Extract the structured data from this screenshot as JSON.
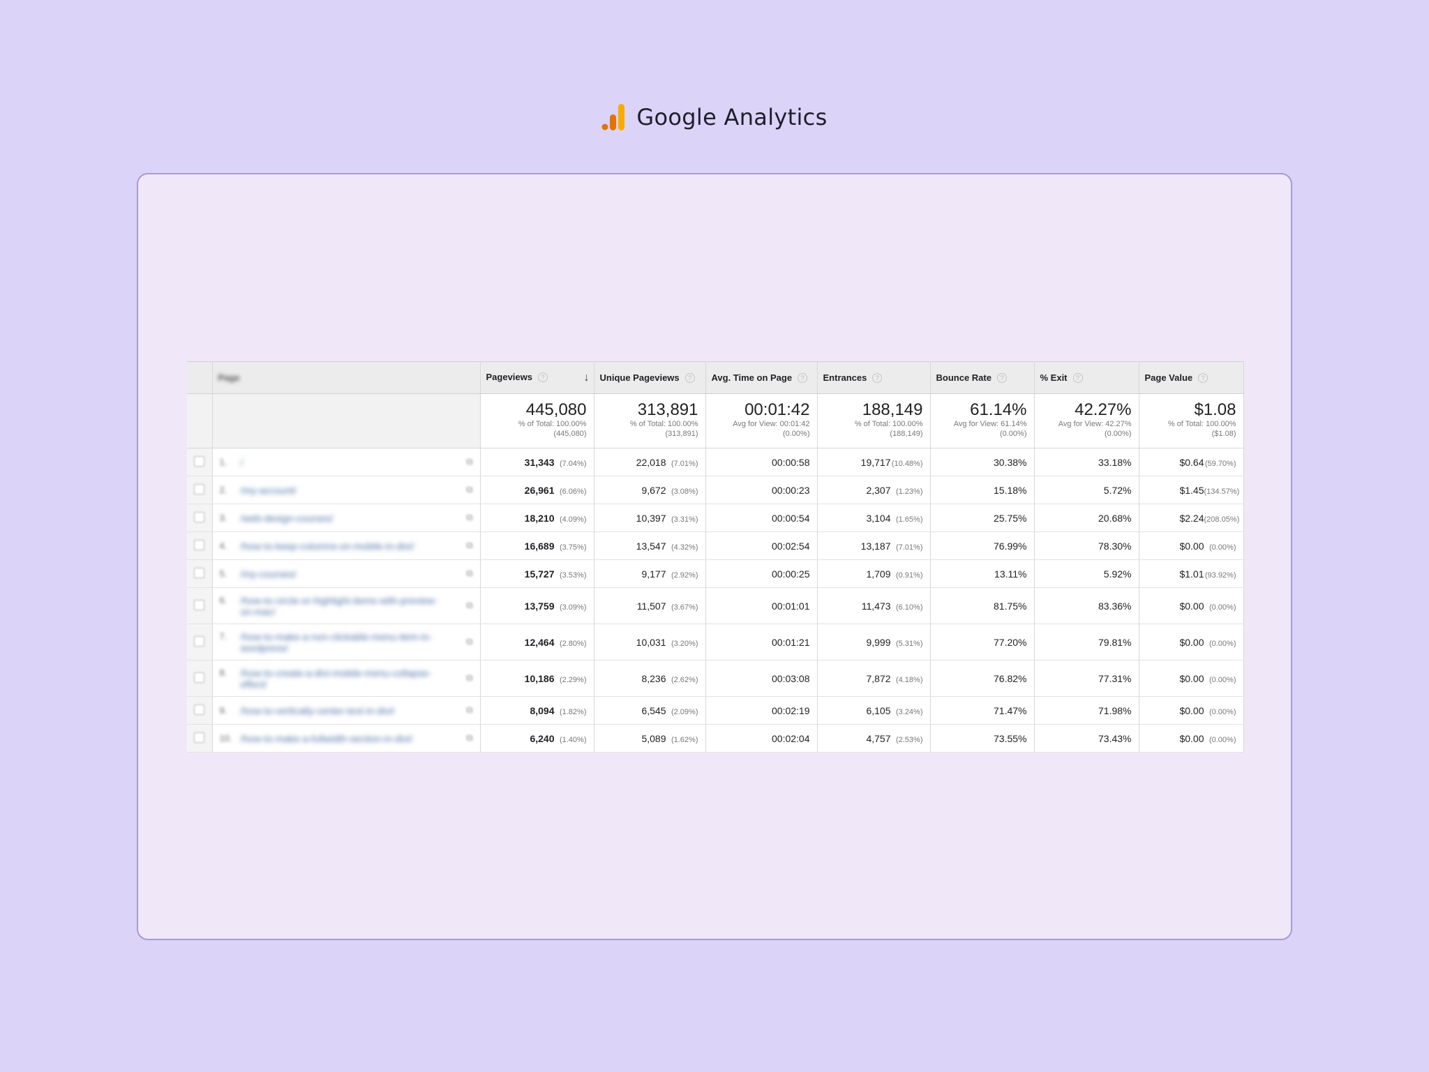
{
  "brand": {
    "title": "Google Analytics",
    "icon": "analytics-bars-icon",
    "colors": [
      "#f9ab00",
      "#e37400"
    ]
  },
  "columns": [
    {
      "label": "Page",
      "blurred": true
    },
    {
      "label": "Pageviews",
      "sorted": "descending"
    },
    {
      "label": "Unique Pageviews"
    },
    {
      "label": "Avg. Time on Page"
    },
    {
      "label": "Entrances"
    },
    {
      "label": "Bounce Rate"
    },
    {
      "label": "% Exit"
    },
    {
      "label": "Page Value"
    }
  ],
  "totals": {
    "pageviews": {
      "value": "445,080",
      "line1": "% of Total: 100.00%",
      "line2": "(445,080)"
    },
    "unique": {
      "value": "313,891",
      "line1": "% of Total: 100.00%",
      "line2": "(313,891)"
    },
    "time": {
      "value": "00:01:42",
      "line1": "Avg for View: 00:01:42",
      "line2": "(0.00%)"
    },
    "entrances": {
      "value": "188,149",
      "line1": "% of Total: 100.00%",
      "line2": "(188,149)"
    },
    "bounce": {
      "value": "61.14%",
      "line1": "Avg for View: 61.14%",
      "line2": "(0.00%)"
    },
    "exit": {
      "value": "42.27%",
      "line1": "Avg for View: 42.27%",
      "line2": "(0.00%)"
    },
    "value": {
      "value": "$1.08",
      "line1": "% of Total: 100.00%",
      "line2": "($1.08)"
    }
  },
  "rows": [
    {
      "num": "1.",
      "page": "/",
      "pageviews": "31,343",
      "pageviews_pct": "(7.04%)",
      "unique": "22,018",
      "unique_pct": "(7.01%)",
      "time": "00:00:58",
      "entrances": "19,717",
      "entrances_pct": "(10.48%)",
      "bounce": "30.38%",
      "exit": "33.18%",
      "value": "$0.64",
      "value_pct": "(59.70%)"
    },
    {
      "num": "2.",
      "page": "/my-account/",
      "pageviews": "26,961",
      "pageviews_pct": "(6.06%)",
      "unique": "9,672",
      "unique_pct": "(3.08%)",
      "time": "00:00:23",
      "entrances": "2,307",
      "entrances_pct": "(1.23%)",
      "bounce": "15.18%",
      "exit": "5.72%",
      "value": "$1.45",
      "value_pct": "(134.57%)"
    },
    {
      "num": "3.",
      "page": "/web-design-courses/",
      "pageviews": "18,210",
      "pageviews_pct": "(4.09%)",
      "unique": "10,397",
      "unique_pct": "(3.31%)",
      "time": "00:00:54",
      "entrances": "3,104",
      "entrances_pct": "(1.65%)",
      "bounce": "25.75%",
      "exit": "20.68%",
      "value": "$2.24",
      "value_pct": "(208.05%)"
    },
    {
      "num": "4.",
      "page": "/how-to-keep-columns-on-mobile-in-divi/",
      "pageviews": "16,689",
      "pageviews_pct": "(3.75%)",
      "unique": "13,547",
      "unique_pct": "(4.32%)",
      "time": "00:02:54",
      "entrances": "13,187",
      "entrances_pct": "(7.01%)",
      "bounce": "76.99%",
      "exit": "78.30%",
      "value": "$0.00",
      "value_pct": "(0.00%)"
    },
    {
      "num": "5.",
      "page": "/my-courses/",
      "pageviews": "15,727",
      "pageviews_pct": "(3.53%)",
      "unique": "9,177",
      "unique_pct": "(2.92%)",
      "time": "00:00:25",
      "entrances": "1,709",
      "entrances_pct": "(0.91%)",
      "bounce": "13.11%",
      "exit": "5.92%",
      "value": "$1.01",
      "value_pct": "(93.92%)"
    },
    {
      "num": "6.",
      "page": "/how-to-circle-or-highlight-items-with-preview-on-mac/",
      "pageviews": "13,759",
      "pageviews_pct": "(3.09%)",
      "unique": "11,507",
      "unique_pct": "(3.67%)",
      "time": "00:01:01",
      "entrances": "11,473",
      "entrances_pct": "(6.10%)",
      "bounce": "81.75%",
      "exit": "83.36%",
      "value": "$0.00",
      "value_pct": "(0.00%)"
    },
    {
      "num": "7.",
      "page": "/how-to-make-a-non-clickable-menu-item-in-wordpress/",
      "pageviews": "12,464",
      "pageviews_pct": "(2.80%)",
      "unique": "10,031",
      "unique_pct": "(3.20%)",
      "time": "00:01:21",
      "entrances": "9,999",
      "entrances_pct": "(5.31%)",
      "bounce": "77.20%",
      "exit": "79.81%",
      "value": "$0.00",
      "value_pct": "(0.00%)"
    },
    {
      "num": "8.",
      "page": "/how-to-create-a-divi-mobile-menu-collapse-effect/",
      "pageviews": "10,186",
      "pageviews_pct": "(2.29%)",
      "unique": "8,236",
      "unique_pct": "(2.62%)",
      "time": "00:03:08",
      "entrances": "7,872",
      "entrances_pct": "(4.18%)",
      "bounce": "76.82%",
      "exit": "77.31%",
      "value": "$0.00",
      "value_pct": "(0.00%)"
    },
    {
      "num": "9.",
      "page": "/how-to-vertically-center-text-in-divi/",
      "pageviews": "8,094",
      "pageviews_pct": "(1.82%)",
      "unique": "6,545",
      "unique_pct": "(2.09%)",
      "time": "00:02:19",
      "entrances": "6,105",
      "entrances_pct": "(3.24%)",
      "bounce": "71.47%",
      "exit": "71.98%",
      "value": "$0.00",
      "value_pct": "(0.00%)"
    },
    {
      "num": "10.",
      "page": "/how-to-make-a-fullwidth-section-in-divi/",
      "pageviews": "6,240",
      "pageviews_pct": "(1.40%)",
      "unique": "5,089",
      "unique_pct": "(1.62%)",
      "time": "00:02:04",
      "entrances": "4,757",
      "entrances_pct": "(2.53%)",
      "bounce": "73.55%",
      "exit": "73.43%",
      "value": "$0.00",
      "value_pct": "(0.00%)"
    }
  ]
}
